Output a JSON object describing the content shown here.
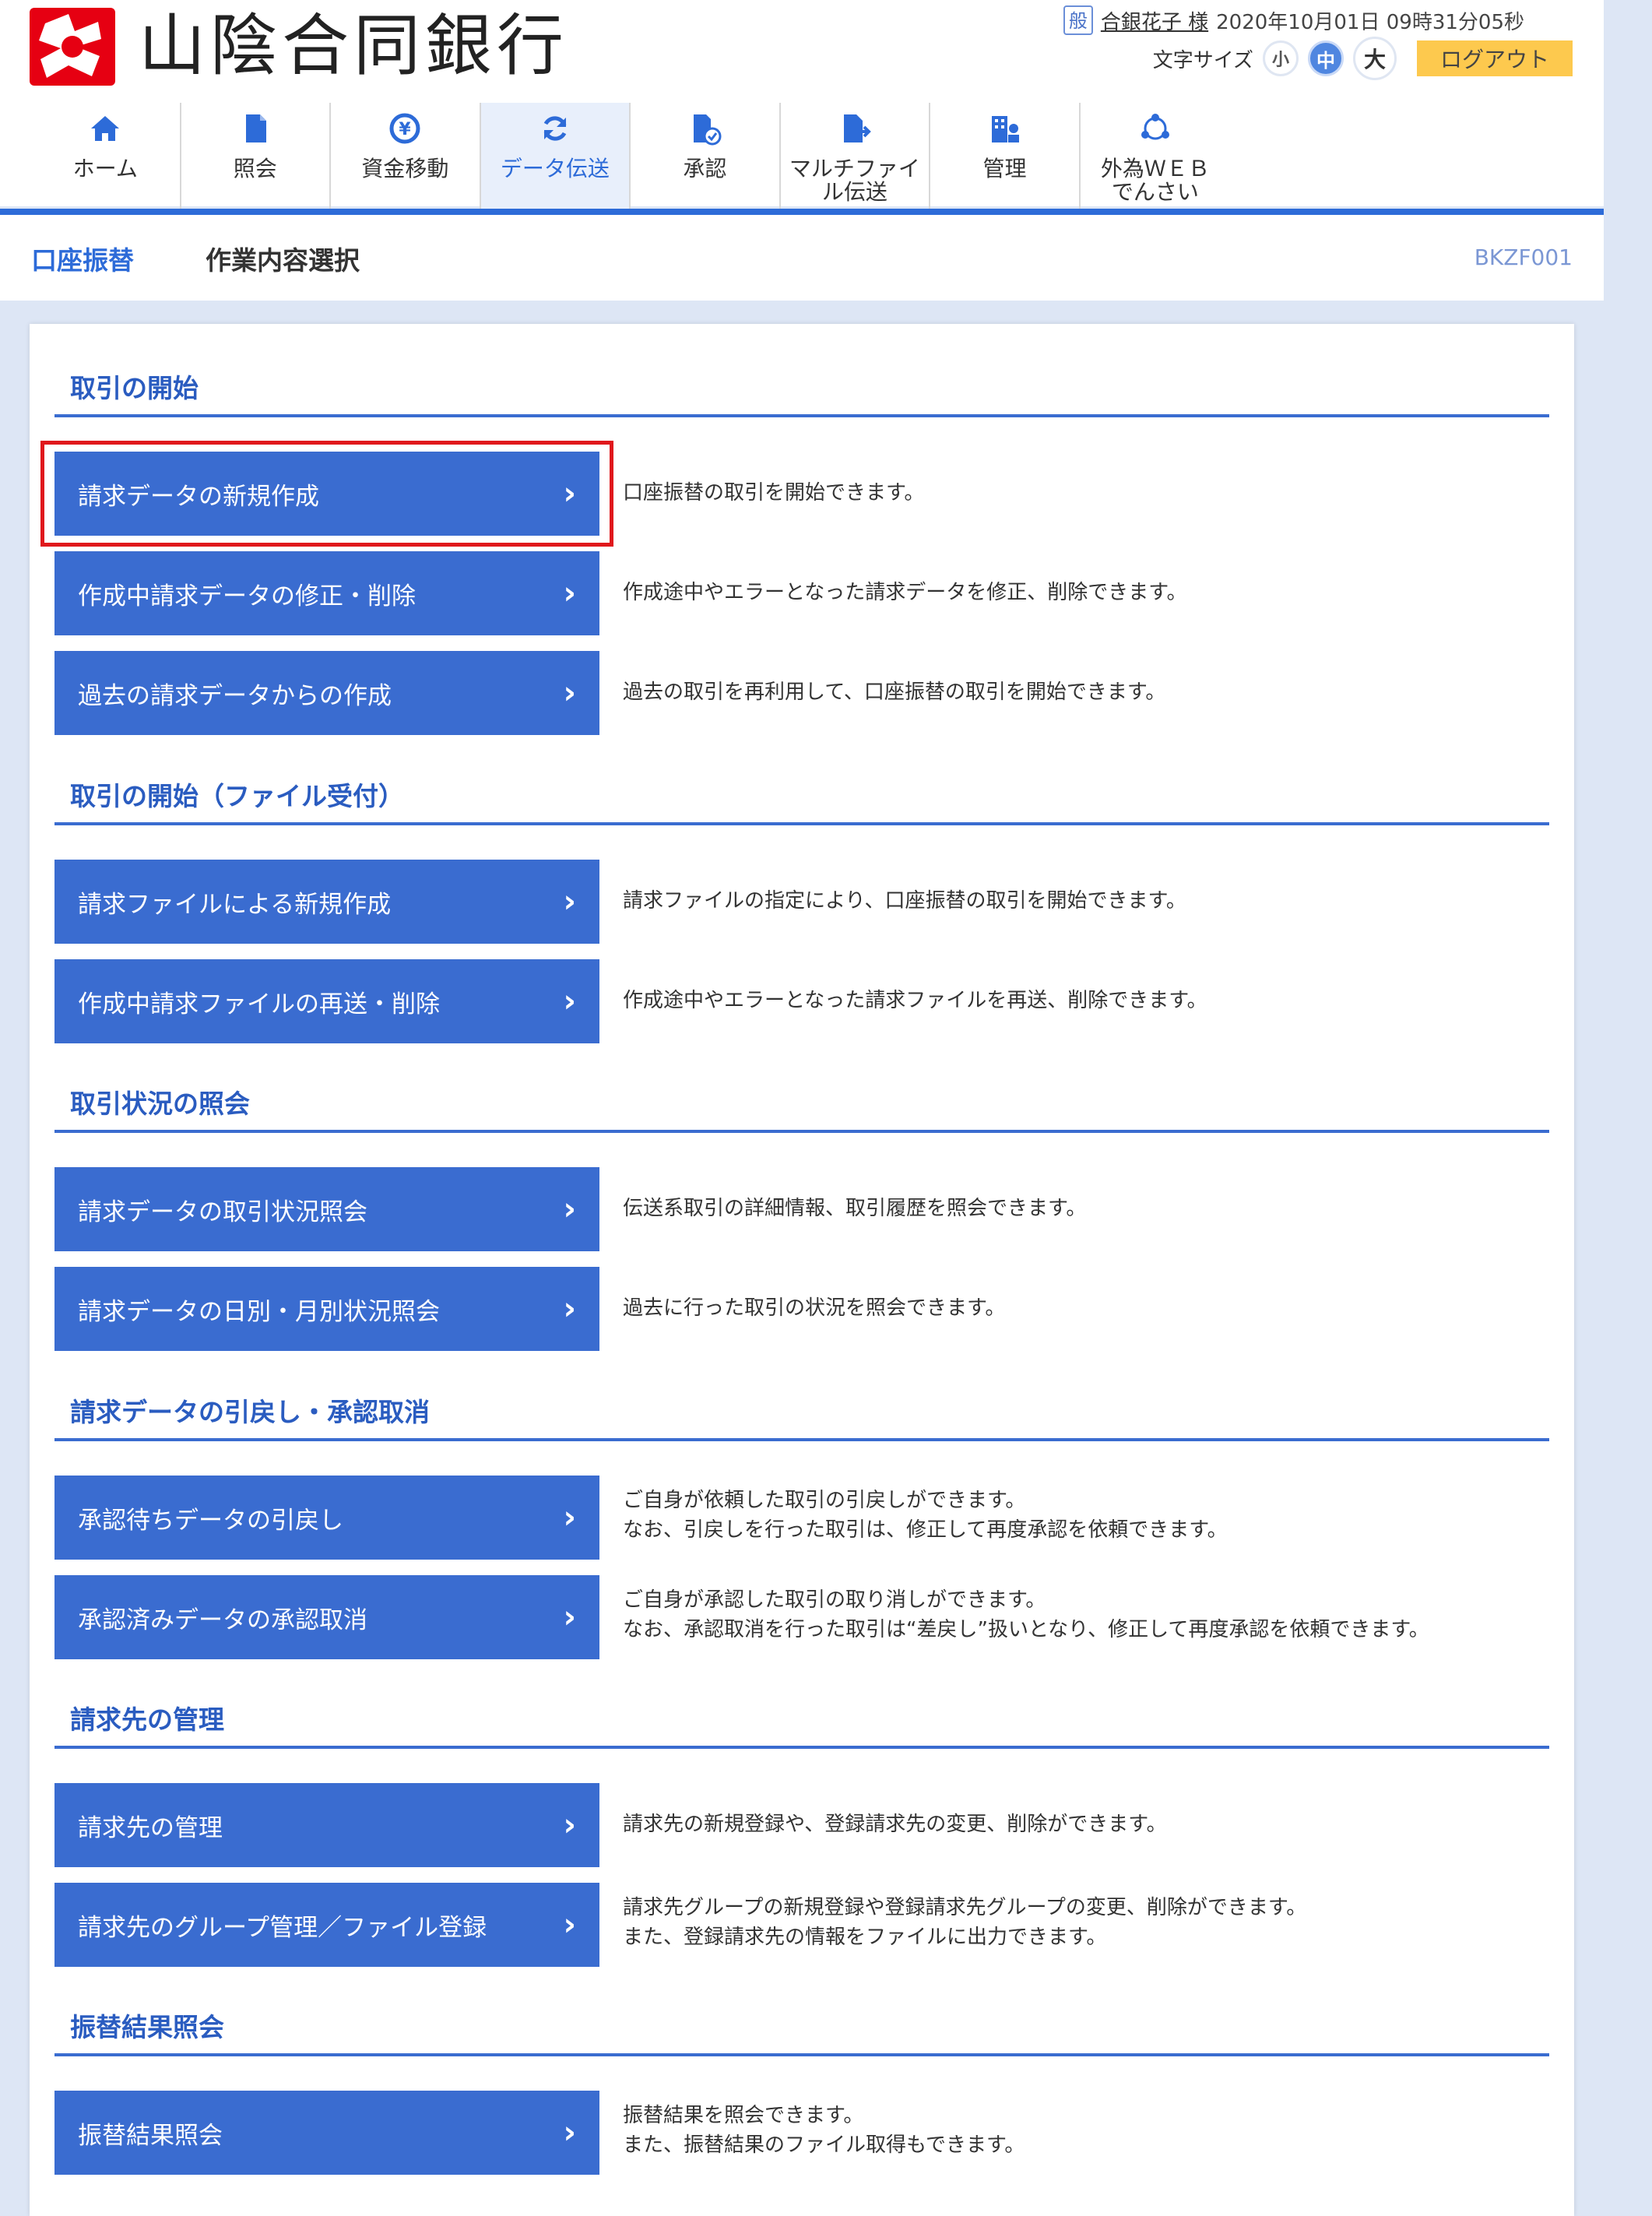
{
  "header": {
    "bank_name": "山陰合同銀行",
    "user_badge": "般",
    "user_name": "合銀花子 様",
    "datetime": "2020年10月01日 09時31分05秒",
    "font_size_label": "文字サイズ",
    "font_sizes": [
      "小",
      "中",
      "大"
    ],
    "logout": "ログアウト"
  },
  "nav": [
    {
      "label": "ホーム",
      "icon": "home-icon"
    },
    {
      "label": "照会",
      "icon": "document-icon"
    },
    {
      "label": "資金移動",
      "icon": "yen-transfer-icon"
    },
    {
      "label": "データ伝送",
      "icon": "sync-icon"
    },
    {
      "label": "承認",
      "icon": "approve-icon"
    },
    {
      "label": "マルチファイル伝送",
      "icon": "file-send-icon"
    },
    {
      "label": "管理",
      "icon": "admin-icon"
    },
    {
      "label": "外為ＷＥＢでんさい",
      "icon": "network-icon"
    }
  ],
  "breadcrumb": {
    "main": "口座振替",
    "sub": "作業内容選択",
    "screen_id": "BKZF001"
  },
  "sections": [
    {
      "title": "取引の開始",
      "items": [
        {
          "label": "請求データの新規作成",
          "desc": [
            "口座振替の取引を開始できます。"
          ]
        },
        {
          "label": "作成中請求データの修正・削除",
          "desc": [
            "作成途中やエラーとなった請求データを修正、削除できます。"
          ]
        },
        {
          "label": "過去の請求データからの作成",
          "desc": [
            "過去の取引を再利用して、口座振替の取引を開始できます。"
          ]
        }
      ]
    },
    {
      "title": "取引の開始（ファイル受付）",
      "items": [
        {
          "label": "請求ファイルによる新規作成",
          "desc": [
            "請求ファイルの指定により、口座振替の取引を開始できます。"
          ]
        },
        {
          "label": "作成中請求ファイルの再送・削除",
          "desc": [
            "作成途中やエラーとなった請求ファイルを再送、削除できます。"
          ]
        }
      ]
    },
    {
      "title": "取引状況の照会",
      "items": [
        {
          "label": "請求データの取引状況照会",
          "desc": [
            "伝送系取引の詳細情報、取引履歴を照会できます。"
          ]
        },
        {
          "label": "請求データの日別・月別状況照会",
          "desc": [
            "過去に行った取引の状況を照会できます。"
          ]
        }
      ]
    },
    {
      "title": "請求データの引戻し・承認取消",
      "items": [
        {
          "label": "承認待ちデータの引戻し",
          "desc": [
            "ご自身が依頼した取引の引戻しができます。",
            "なお、引戻しを行った取引は、修正して再度承認を依頼できます。"
          ]
        },
        {
          "label": "承認済みデータの承認取消",
          "desc": [
            "ご自身が承認した取引の取り消しができます。",
            "なお、承認取消を行った取引は“差戻し”扱いとなり、修正して再度承認を依頼できます。"
          ]
        }
      ]
    },
    {
      "title": "請求先の管理",
      "items": [
        {
          "label": "請求先の管理",
          "desc": [
            "請求先の新規登録や、登録請求先の変更、削除ができます。"
          ]
        },
        {
          "label": "請求先のグループ管理／ファイル登録",
          "desc": [
            "請求先グループの新規登録や登録請求先グループの変更、削除ができます。",
            "また、登録請求先の情報をファイルに出力できます。"
          ]
        }
      ]
    },
    {
      "title": "振替結果照会",
      "items": [
        {
          "label": "振替結果照会",
          "desc": [
            "振替結果を照会できます。",
            "また、振替結果のファイル取得もできます。"
          ]
        }
      ]
    }
  ],
  "colors": {
    "primary": "#3a6cd0",
    "accent_red": "#e0181c",
    "logout_bg": "#fdc94e",
    "page_bg": "#dde6f5"
  }
}
